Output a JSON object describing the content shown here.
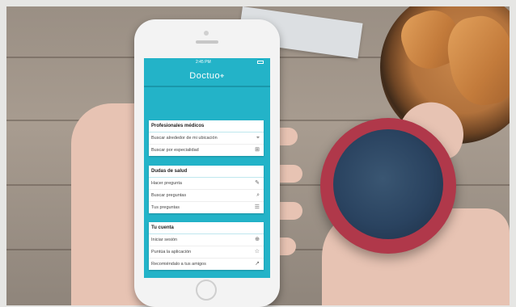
{
  "app": {
    "title": "Doctuo",
    "pin_icon": "location-pin-icon"
  },
  "statusbar": {
    "time": "2:45 PM"
  },
  "sections": [
    {
      "title": "Profesionales médicos",
      "items": [
        {
          "label": "Buscar alrededor de mi ubicación",
          "icon": "location-pin-icon"
        },
        {
          "label": "Buscar por especialidad",
          "icon": "medical-kit-icon"
        }
      ]
    },
    {
      "title": "Dudas de salud",
      "items": [
        {
          "label": "Hacer pregunta",
          "icon": "edit-icon"
        },
        {
          "label": "Buscar preguntas",
          "icon": "search-icon"
        },
        {
          "label": "Tus preguntas",
          "icon": "list-icon"
        }
      ]
    },
    {
      "title": "Tu cuenta",
      "items": [
        {
          "label": "Iniciar sesión",
          "icon": "login-icon"
        },
        {
          "label": "Puntúa la aplicación",
          "icon": "star-icon"
        },
        {
          "label": "Recomiéndalo a tus amigos",
          "icon": "share-icon"
        }
      ]
    }
  ],
  "colors": {
    "screen_bg": "#23b3c8",
    "cup": "#b0384a"
  }
}
